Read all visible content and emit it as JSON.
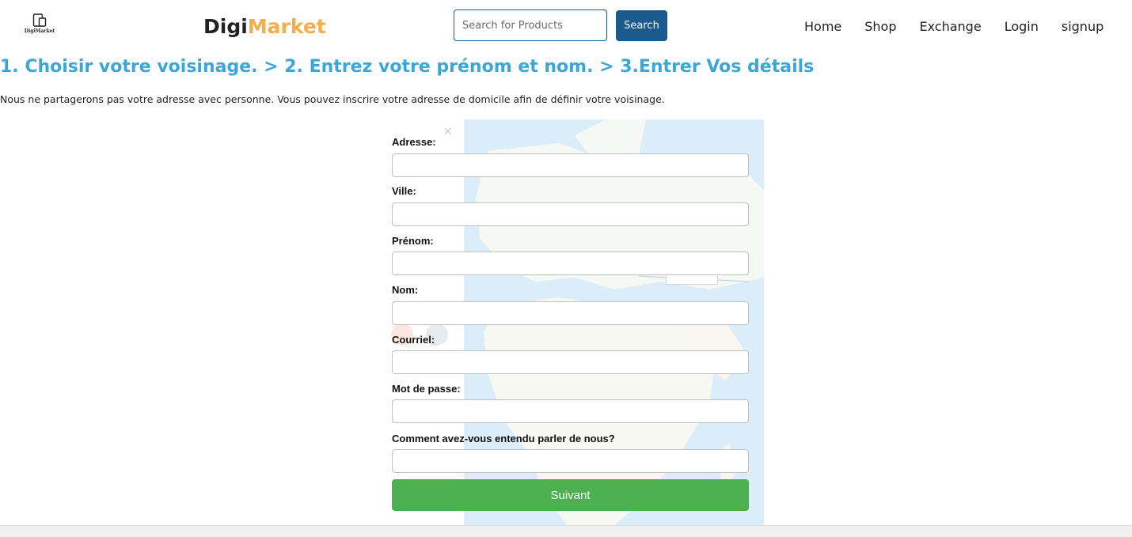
{
  "header": {
    "logo_small_text": "DigiMarket",
    "brand_part1": "Digi",
    "brand_part2": "Market",
    "search_placeholder": "Search for Products",
    "search_button": "Search",
    "nav": [
      "Home",
      "Shop",
      "Exchange",
      "Login",
      "signup"
    ]
  },
  "steps_heading": "1. Choisir votre voisinage. > 2. Entrez votre prénom et nom. > 3.Entrer Vos détails",
  "intro_text": "Nous ne partagerons pas votre adresse avec personne. Vous pouvez inscrire votre adresse de domicile afin de définir votre voisinage.",
  "form": {
    "address_label": "Adresse:",
    "city_label": "Ville:",
    "firstname_label": "Prénom:",
    "lastname_label": "Nom:",
    "email_label": "Courriel:",
    "password_label": "Mot de passe:",
    "source_label": "Comment avez-vous entendu parler de nous?",
    "submit_button": "Suivant"
  },
  "colors": {
    "brand_accent": "#f4ae4c",
    "steps_blue": "#3ea6d6",
    "search_button": "#1c5a8e",
    "submit_green": "#4caf50"
  }
}
